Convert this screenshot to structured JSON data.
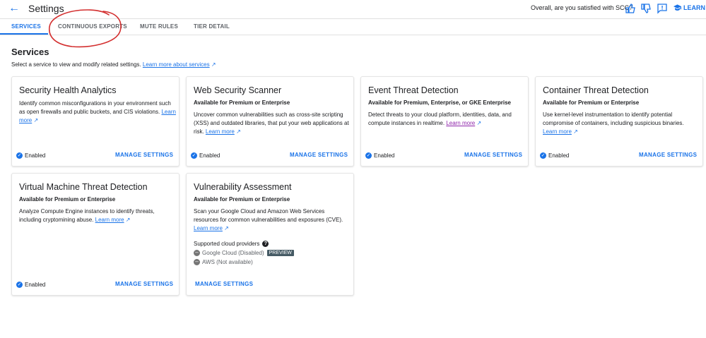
{
  "header": {
    "back_icon": "arrow-left-icon",
    "title": "Settings",
    "satisfaction_prompt": "Overall, are you satisfied with SCC?",
    "thumbs_up_icon": "thumbs-up-icon",
    "thumbs_down_icon": "thumbs-down-icon",
    "feedback_icon": "feedback-icon",
    "learn_label": "LEARN"
  },
  "tabs": [
    {
      "label": "SERVICES",
      "active": true
    },
    {
      "label": "CONTINUOUS EXPORTS",
      "active": false
    },
    {
      "label": "MUTE RULES",
      "active": false
    },
    {
      "label": "TIER DETAIL",
      "active": false
    }
  ],
  "section": {
    "title": "Services",
    "description": "Select a service to view and modify related settings.",
    "learn_link": "Learn more about services"
  },
  "common": {
    "enabled_label": "Enabled",
    "manage_label": "MANAGE SETTINGS",
    "learn_more": "Learn more"
  },
  "cards": [
    {
      "title": "Security Health Analytics",
      "availability": "",
      "description": "Identify common misconfigurations in your environment such as open firewalls and public buckets, and CIS violations."
    },
    {
      "title": "Web Security Scanner",
      "availability": "Available for Premium or Enterprise",
      "description": "Uncover common vulnerabilities such as cross-site scripting (XSS) and outdated libraries, that put your web applications at risk."
    },
    {
      "title": "Event Threat Detection",
      "availability": "Available for Premium, Enterprise, or GKE Enterprise",
      "description": "Detect threats to your cloud platform, identities, data, and compute instances in realtime."
    },
    {
      "title": "Container Threat Detection",
      "availability": "Available for Premium or Enterprise",
      "description": "Use kernel-level instrumentation to identify potential compromise of containers, including suspicious binaries."
    },
    {
      "title": "Virtual Machine Threat Detection",
      "availability": "Available for Premium or Enterprise",
      "description": "Analyze Compute Engine instances to identify threats, including cryptomining abuse."
    },
    {
      "title": "Vulnerability Assessment",
      "availability": "Available for Premium or Enterprise",
      "description": "Scan your Google Cloud and Amazon Web Services resources for common vulnerabilities and exposures (CVE).",
      "providers_title": "Supported cloud providers",
      "providers": [
        {
          "label": "Google Cloud (Disabled)",
          "badge": "PREVIEW"
        },
        {
          "label": "AWS (Not available)",
          "badge": ""
        }
      ]
    }
  ],
  "colors": {
    "accent": "#1a73e8",
    "annotation": "#d32f2f"
  }
}
